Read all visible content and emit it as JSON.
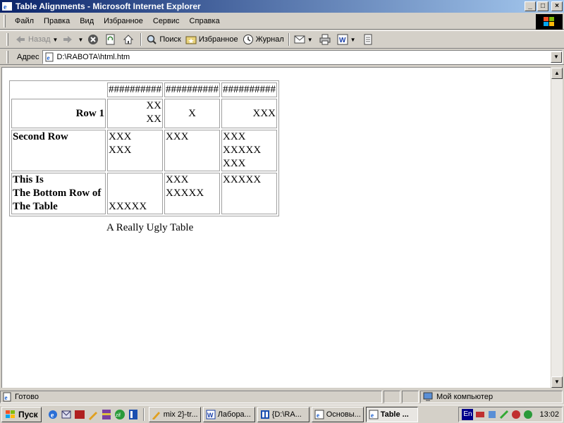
{
  "window": {
    "title": "Table Alignments - Microsoft Internet Explorer",
    "controls": {
      "minimize": "_",
      "maximize": "□",
      "close": "×"
    }
  },
  "menu": [
    "Файл",
    "Правка",
    "Вид",
    "Избранное",
    "Сервис",
    "Справка"
  ],
  "toolbar": {
    "back": "Назад",
    "search": "Поиск",
    "favorites": "Избранное",
    "history": "Журнал"
  },
  "address": {
    "label": "Адрес",
    "url": "D:\\RABOTA\\html.htm"
  },
  "table": {
    "header": [
      "##########",
      "##########",
      "##########"
    ],
    "row1": {
      "label": "Row 1",
      "c1": [
        "XX",
        "XX"
      ],
      "c2": "X",
      "c3": "XXX"
    },
    "row2": {
      "label": "Second Row",
      "c1": [
        "XXX",
        "XXX"
      ],
      "c2": "XXX",
      "c3": [
        "XXX",
        "XXXXX",
        "XXX"
      ]
    },
    "row3": {
      "label": [
        "This Is",
        "The Bottom Row of",
        "The Table"
      ],
      "c1": "XXXXX",
      "c2": [
        "XXX",
        "XXXXX"
      ],
      "c3": "XXXXX"
    },
    "caption": "A Really Ugly Table"
  },
  "status": {
    "text": "Готово",
    "zone": "Мой компьютер"
  },
  "taskbar": {
    "start": "Пуск",
    "tasks": [
      "mix 2}-tr...",
      "Лабора...",
      "{D:\\RA...",
      "Основы...",
      "Table ..."
    ],
    "lang": "En",
    "clock": "13:02"
  },
  "colors": {
    "title_start": "#0a246a",
    "title_end": "#a6caf0",
    "chrome": "#d4d0c8"
  }
}
